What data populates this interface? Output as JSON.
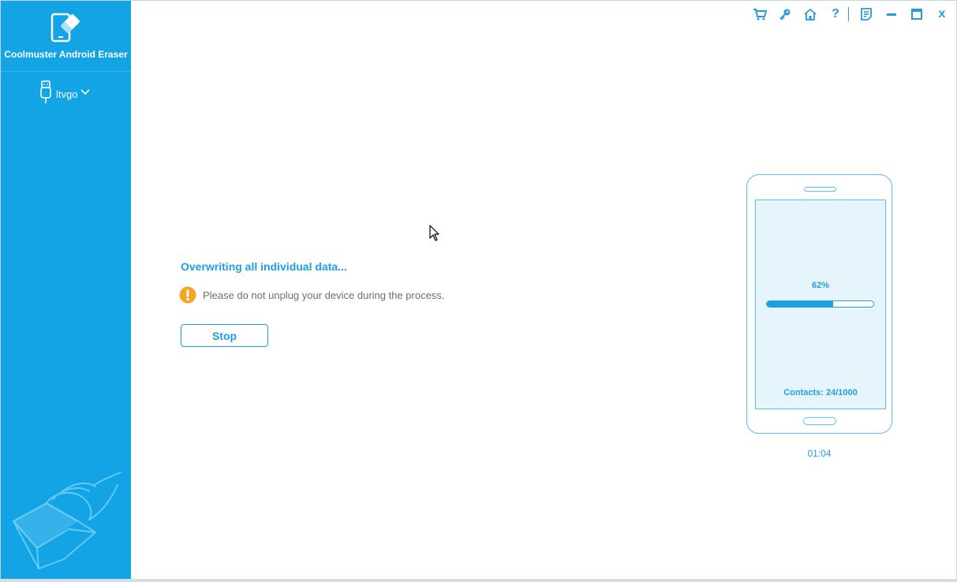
{
  "app": {
    "name": "Coolmuster Android Eraser",
    "brand_color": "#13a4e6",
    "accent_color": "#1f9ee3"
  },
  "sidebar": {
    "device": {
      "icon": "usb-icon",
      "name": "ltvgo",
      "dropdown_icon": "chevron-down-icon"
    }
  },
  "titlebar": {
    "buttons": [
      {
        "name": "cart-icon"
      },
      {
        "name": "key-icon"
      },
      {
        "name": "home-icon"
      },
      {
        "name": "help-icon",
        "label": "?"
      },
      {
        "name": "feedback-icon"
      },
      {
        "name": "minimize-icon"
      },
      {
        "name": "maximize-icon"
      },
      {
        "name": "close-icon",
        "label": "x"
      }
    ]
  },
  "main": {
    "status_title": "Overwriting all individual data...",
    "warning_icon": "warning-icon",
    "warning_text": "Please do not unplug your device during the process.",
    "stop_label": "Stop"
  },
  "progress": {
    "percent_label": "62%",
    "fraction": 0.62,
    "contacts_label": "Contacts: 24/1000",
    "elapsed": "01:04"
  }
}
